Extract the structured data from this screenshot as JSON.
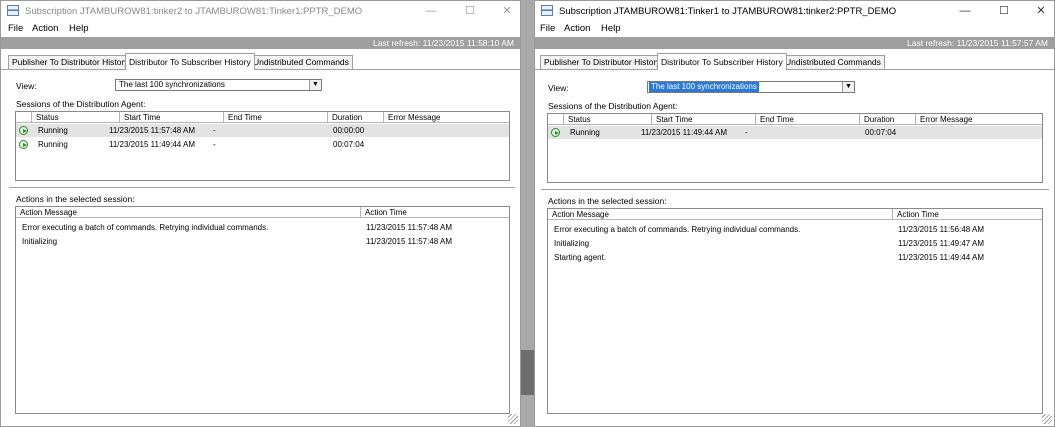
{
  "left": {
    "title": "Subscription JTAMBUROW81:tinker2 to JTAMBUROW81:Tinker1:PPTR_DEMO",
    "menu": [
      "File",
      "Action",
      "Help"
    ],
    "refresh": "Last refresh: 11/23/2015 11:58:10 AM",
    "tabs": [
      "Publisher To Distributor History",
      "Distributor To Subscriber History",
      "Undistributed Commands"
    ],
    "view_label": "View:",
    "view_value": "The last 100 synchronizations",
    "sessions_label": "Sessions of the Distribution Agent:",
    "session_columns": [
      "Status",
      "Start Time",
      "End Time",
      "Duration",
      "Error Message"
    ],
    "sessions": [
      {
        "status": "Running",
        "start": "11/23/2015 11:57:48 AM",
        "end": "-",
        "duration": "00:00:00",
        "error": ""
      },
      {
        "status": "Running",
        "start": "11/23/2015 11:49:44 AM",
        "end": "-",
        "duration": "00:07:04",
        "error": ""
      }
    ],
    "actions_label": "Actions in the selected session:",
    "action_columns": [
      "Action Message",
      "Action Time"
    ],
    "actions": [
      {
        "message": "Error executing a batch of commands. Retrying individual commands.",
        "time": "11/23/2015 11:57:48 AM"
      },
      {
        "message": "Initializing",
        "time": "11/23/2015 11:57:48 AM"
      }
    ]
  },
  "right": {
    "title": "Subscription JTAMBUROW81:Tinker1 to JTAMBUROW81:tinker2:PPTR_DEMO",
    "menu": [
      "File",
      "Action",
      "Help"
    ],
    "refresh": "Last refresh: 11/23/2015 11:57:57 AM",
    "tabs": [
      "Publisher To Distributor History",
      "Distributor To Subscriber History",
      "Undistributed Commands"
    ],
    "view_label": "View:",
    "view_value": "The last 100 synchronizations",
    "sessions_label": "Sessions of the Distribution Agent:",
    "session_columns": [
      "Status",
      "Start Time",
      "End Time",
      "Duration",
      "Error Message"
    ],
    "sessions": [
      {
        "status": "Running",
        "start": "11/23/2015 11:49:44 AM",
        "end": "-",
        "duration": "00:07:04",
        "error": ""
      }
    ],
    "actions_label": "Actions in the selected session:",
    "action_columns": [
      "Action Message",
      "Action Time"
    ],
    "actions": [
      {
        "message": "Error executing a batch of commands. Retrying individual commands.",
        "time": "11/23/2015 11:56:48 AM"
      },
      {
        "message": "Initializing",
        "time": "11/23/2015 11:49:47 AM"
      },
      {
        "message": "Starting agent.",
        "time": "11/23/2015 11:49:44 AM"
      }
    ]
  },
  "caption_glyphs": {
    "minimize": "—",
    "maximize": "☐",
    "close": "✕"
  },
  "colors": {
    "refresh_bar": "#9f9f9f",
    "selected_row": "#e3e3e3",
    "combo_highlight": "#2b7ad6",
    "running_icon": "#2b8a2b"
  }
}
